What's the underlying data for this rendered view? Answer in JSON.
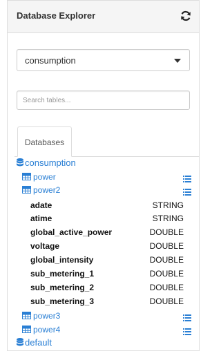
{
  "panel": {
    "title": "Database Explorer",
    "refresh_icon": "refresh-icon"
  },
  "database_select": {
    "value": "consumption"
  },
  "search": {
    "placeholder": "Search tables..."
  },
  "tabs": [
    {
      "label": "Databases",
      "active": true
    }
  ],
  "tree": {
    "databases": [
      {
        "name": "consumption",
        "icon": "database-icon",
        "tables": [
          {
            "name": "power",
            "expanded": false
          },
          {
            "name": "power2",
            "expanded": true,
            "columns": [
              {
                "name": "adate",
                "type": "STRING"
              },
              {
                "name": "atime",
                "type": "STRING"
              },
              {
                "name": "global_active_power",
                "type": "DOUBLE"
              },
              {
                "name": "voltage",
                "type": "DOUBLE"
              },
              {
                "name": "global_intensity",
                "type": "DOUBLE"
              },
              {
                "name": "sub_metering_1",
                "type": "DOUBLE"
              },
              {
                "name": "sub_metering_2",
                "type": "DOUBLE"
              },
              {
                "name": "sub_metering_3",
                "type": "DOUBLE"
              }
            ]
          },
          {
            "name": "power3",
            "expanded": false
          },
          {
            "name": "power4",
            "expanded": false
          }
        ]
      },
      {
        "name": "default",
        "icon": "database-icon",
        "tables": []
      }
    ]
  },
  "colors": {
    "link": "#2a7fd4",
    "border": "#dddddd",
    "heading_bg": "#f5f5f5"
  }
}
